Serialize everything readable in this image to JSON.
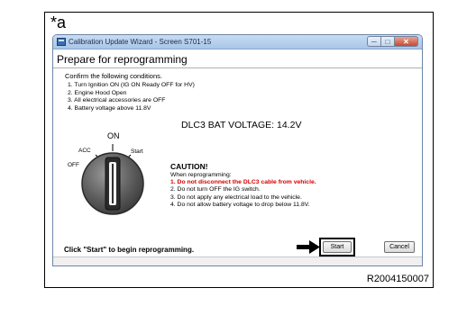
{
  "figure": {
    "label": "*a",
    "reference": "R2004150007"
  },
  "window": {
    "title": "Calibration Update Wizard - Screen S701-15",
    "controls": {
      "minimize": "─",
      "maximize": "□",
      "close": "✕"
    }
  },
  "page": {
    "heading": "Prepare for reprogramming",
    "intro": "Confirm the following conditions.",
    "conditions": [
      "1. Turn Ignition ON (IG ON Ready OFF for HV)",
      "2. Engine Hood Open",
      "3. All electrical accessories are OFF",
      "4. Battery voltage above 11.8V"
    ],
    "voltage_reading": "DLC3 BAT VOLTAGE: 14.2V",
    "ignition_switch": {
      "on": "ON",
      "acc": "ACC",
      "off": "OFF",
      "start": "Start"
    },
    "caution": {
      "title": "CAUTION!",
      "intro": "When reprogramming:",
      "items": [
        "1. Do not disconnect the DLC3 cable from vehicle.",
        "2. Do not turn OFF the IG switch.",
        "3. Do not apply any electrical load to the vehicle.",
        "4. Do not allow battery voltage to drop below 11.8V."
      ]
    },
    "instruction": "Click \"Start\" to begin reprogramming."
  },
  "buttons": {
    "start": "Start",
    "cancel": "Cancel"
  },
  "colors": {
    "warning": "#d40000",
    "titlebar": "#a9c6e8"
  }
}
